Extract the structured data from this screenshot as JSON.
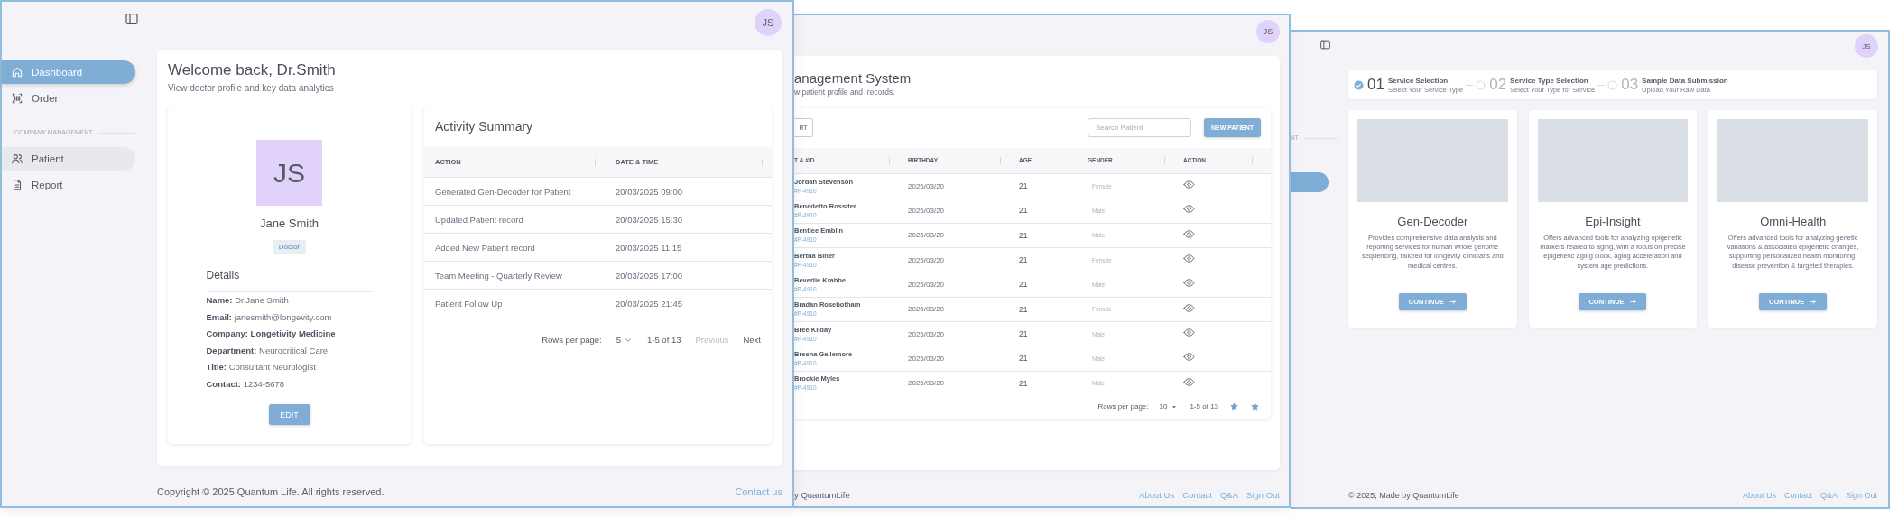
{
  "services_window": {
    "sidebar_fragment": {
      "section_label": "NT",
      "items": [
        {
          "selected": true
        }
      ]
    },
    "avatar": "JS",
    "steps": [
      {
        "number": "01",
        "title": "Service Selection",
        "subtitle": "Select Your Service Type",
        "completed": true
      },
      {
        "number": "02",
        "title": "Service Type Selection",
        "subtitle": "Select Your Type for Service",
        "completed": false
      },
      {
        "number": "03",
        "title": "Sample Data Submission",
        "subtitle": "Upload Your Raw Data",
        "completed": false
      }
    ],
    "services": [
      {
        "title": "Gen-Decoder",
        "description": "Provides comprehensive data analysis and reporting services for human whole genome sequencing, tailored for longevity clinicians and medical centres.",
        "button": "CONTINUE"
      },
      {
        "title": "Epi-Insight",
        "description": "Offers advanced tools for analyzing epigenetic markers related to aging, with a focus on precise epigenetic aging clock, aging acceleration and system age predictions.",
        "button": "CONTINUE"
      },
      {
        "title": "Omni-Health",
        "description": "Offers advanced tools for analyzing genetic variations & associated epigenetic changes, supporting personalized health monitoring, disease prevention & targeted therapies.",
        "button": "CONTINUE"
      }
    ],
    "footer": {
      "credit": "© 2025, Made by QuantumLife",
      "links": [
        "About Us",
        "Contact",
        "Q&A",
        "Sign Out"
      ]
    }
  },
  "patients_window": {
    "avatar": "JS",
    "title": "anagement System",
    "subtitle": "w patient profile and  records.",
    "export_button": "RT",
    "search": {
      "placeholder": "Search Patient"
    },
    "new_button": "NEW PATIENT",
    "columns": [
      "T & #ID",
      "BIRTHDAY",
      "AGE",
      "GENDER",
      "ACTION"
    ],
    "rows": [
      {
        "name": "Jordan Stevenson",
        "id": "#P-4910",
        "birthday": "2025/03/20",
        "age": "21",
        "gender": "Female"
      },
      {
        "name": "Benedetto Rossiter",
        "id": "#P-4910",
        "birthday": "2025/03/20",
        "age": "21",
        "gender": "Male"
      },
      {
        "name": "Bentlee Emblin",
        "id": "#P-4910",
        "birthday": "2025/03/20",
        "age": "21",
        "gender": "Male"
      },
      {
        "name": "Bertha Biner",
        "id": "#P-4910",
        "birthday": "2025/03/20",
        "age": "21",
        "gender": "Female"
      },
      {
        "name": "Beverlie Krabbe",
        "id": "#P-4910",
        "birthday": "2025/03/20",
        "age": "21",
        "gender": "Male"
      },
      {
        "name": "Bradan Rosebotham",
        "id": "#P-4910",
        "birthday": "2025/03/20",
        "age": "21",
        "gender": "Female"
      },
      {
        "name": "Bree Kilday",
        "id": "#P-4910",
        "birthday": "2025/03/20",
        "age": "21",
        "gender": "Male"
      },
      {
        "name": "Breena Gallemore",
        "id": "#P-4910",
        "birthday": "2025/03/20",
        "age": "21",
        "gender": "Male"
      },
      {
        "name": "Brockie Myles",
        "id": "#P-4910",
        "birthday": "2025/03/20",
        "age": "21",
        "gender": "Male"
      }
    ],
    "pagination": {
      "rows_per_page_label": "Rows per page:",
      "rows_per_page": "10",
      "range": "1-5 of 13"
    },
    "footer": {
      "credit": "y QuantumLife",
      "links": [
        "About Us",
        "Contact",
        "Q&A",
        "Sign Out"
      ]
    }
  },
  "dashboard_window": {
    "avatar": "JS",
    "sidebar": {
      "items": [
        {
          "label": "Dashboard",
          "selected": true,
          "highlighted": false
        },
        {
          "label": "Order",
          "selected": false,
          "highlighted": false
        }
      ],
      "sections": [
        {
          "title": "COMPANY MANAGEMENT",
          "items": [
            {
              "label": "Patient",
              "selected": false,
              "highlighted": true
            },
            {
              "label": "Report",
              "selected": false,
              "highlighted": false
            }
          ]
        }
      ]
    },
    "title": "Welcome back, Dr.Smith",
    "subtitle": "View doctor profile and key data analytics",
    "profile": {
      "initials": "JS",
      "name": "Jane Smith",
      "role": "Doctor",
      "details_title": "Details",
      "details": [
        {
          "label": "Name:",
          "value": "Dr.Jane Smith",
          "value_bold": false
        },
        {
          "label": "Email:",
          "value": "janesmith@longevity.com",
          "value_bold": false
        },
        {
          "label": "Company:",
          "value": "Longetivity Medicine",
          "value_bold": true
        },
        {
          "label": "Department:",
          "value": "Neurocritical Care",
          "value_bold": false
        },
        {
          "label": "Title:",
          "value": "Consultant Neurologist",
          "value_bold": false
        },
        {
          "label": "Contact:",
          "value": "1234-5678",
          "value_bold": false
        }
      ],
      "edit_button": "EDIT"
    },
    "activity": {
      "title": "Activity Summary",
      "columns": [
        "ACTION",
        "DATE & TIME"
      ],
      "rows": [
        [
          "Generated Gen-Decoder for Patient",
          "20/03/2025 09:00"
        ],
        [
          "Updated Patient record",
          "20/03/2025 15:30"
        ],
        [
          "Added New Patient record",
          "20/03/2025 11:15"
        ],
        [
          "Team Meeting - Quarterly Review",
          "20/03/2025 17:00"
        ],
        [
          "Patient Follow Up",
          "20/03/2025 21:45"
        ]
      ],
      "pagination": {
        "rows_per_page_label": "Rows per page:",
        "rows_per_page": "5",
        "range": "1-5 of 13",
        "previous": {
          "label": "Previous",
          "disabled": true
        },
        "next": {
          "label": "Next",
          "disabled": false
        }
      }
    },
    "footer": {
      "copyright": "Copyright © 2025 Quantum Life. All rights reserved.",
      "contact_link": "Contact us"
    }
  }
}
